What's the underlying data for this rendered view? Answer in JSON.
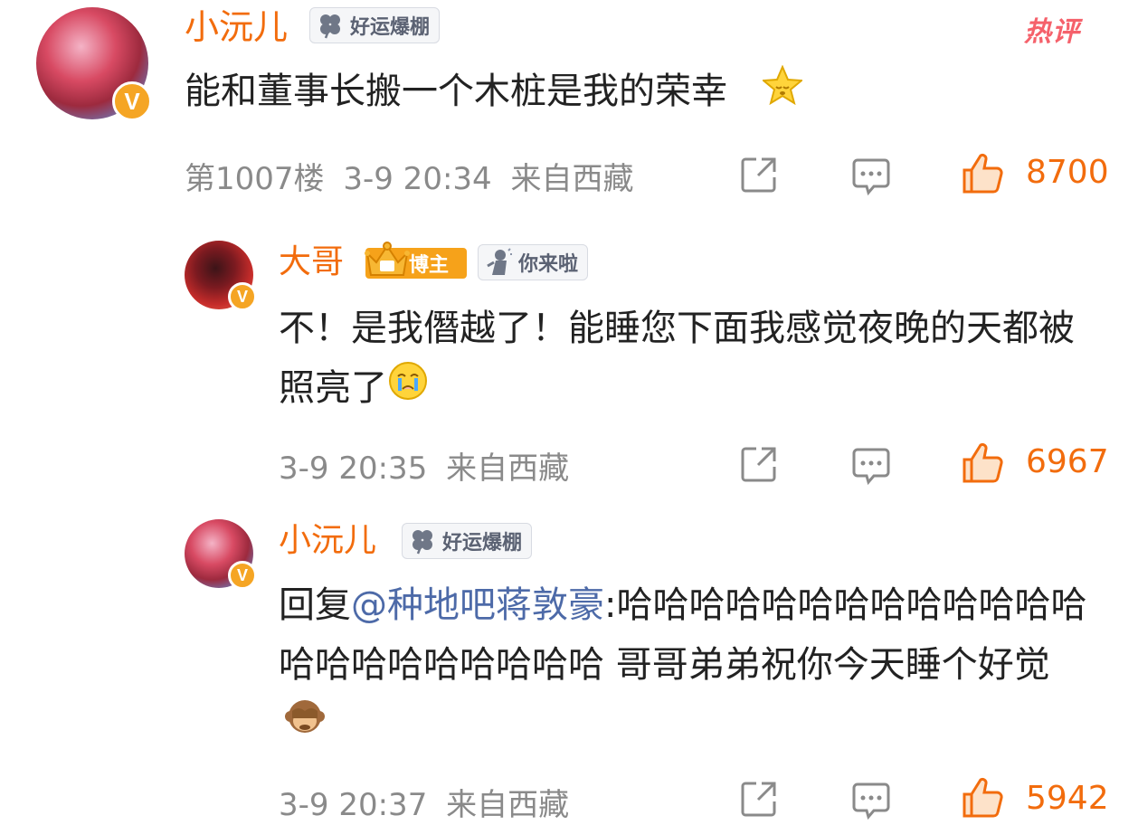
{
  "hot_label": "热评",
  "comment": {
    "user": "小沅儿",
    "badge": "好运爆棚",
    "text": "能和董事长搬一个木桩是我的荣幸",
    "emoji": "star-emoji",
    "floor": "第1007楼",
    "time": "3-9 20:34",
    "location": "来自西藏",
    "likes": "8700"
  },
  "replies": [
    {
      "user": "大哥",
      "author_badge": "博主",
      "badge": "你来啦",
      "text": "不！是我僭越了！能睡您下面我感觉夜晚的天都被照亮了",
      "emoji": "crying-face-emoji",
      "time": "3-9 20:35",
      "location": "来自西藏",
      "likes": "6967"
    },
    {
      "user": "小沅儿",
      "badge": "好运爆棚",
      "reply_prefix": "回复",
      "mention": "@种地吧蒋敦豪",
      "text": ":哈哈哈哈哈哈哈哈哈哈哈哈哈哈哈哈哈哈哈哈哈哈 哥哥弟弟祝你今天睡个好觉",
      "emoji": "see-no-evil-monkey-emoji",
      "time": "3-9 20:37",
      "location": "来自西藏",
      "likes": "5942"
    }
  ],
  "colors": {
    "name": "#f26c0d",
    "like": "#f26c0d",
    "mention": "#4d6aa8",
    "meta": "#8a8a8a",
    "hot": "#f5616b"
  }
}
